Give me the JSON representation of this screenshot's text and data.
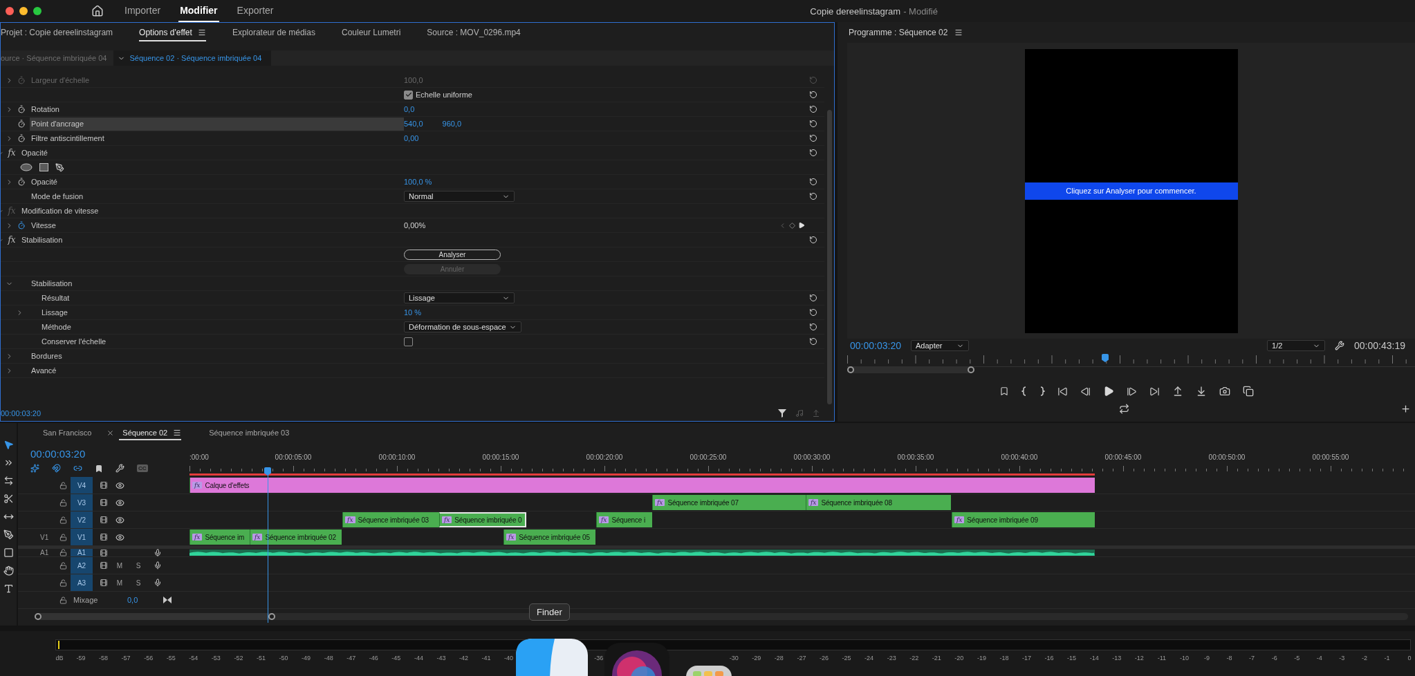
{
  "app_bar": {
    "nav": [
      {
        "label": "Importer",
        "selected": false
      },
      {
        "label": "Modifier",
        "selected": true
      },
      {
        "label": "Exporter",
        "selected": false
      }
    ],
    "title": "Copie dereelinstagram",
    "status": "- Modifié"
  },
  "effects_panel": {
    "tabs": [
      {
        "label": "Projet : Copie dereelinstagram",
        "selected": false
      },
      {
        "label": "Options d'effet",
        "selected": true
      },
      {
        "label": "Explorateur de médias",
        "selected": false
      },
      {
        "label": "Couleur Lumetri",
        "selected": false
      },
      {
        "label": "Source : MOV_0296.mp4",
        "selected": false
      }
    ],
    "source_tab": "ource · Séquence imbriquée 04",
    "sequence_tab": "Séquence 02 · Séquence imbriquée 04",
    "rows": [
      {
        "kind": "property",
        "label": "Largeur d'échelle",
        "values": [
          "100,0"
        ],
        "expandable": true,
        "stopwatch": true,
        "animated": false,
        "disabled": true,
        "highlighted": false,
        "reset": true
      },
      {
        "kind": "checkbox",
        "label": "Echelle uniforme",
        "checked": true,
        "reset": true
      },
      {
        "kind": "property",
        "label": "Rotation",
        "values": [
          "0,0"
        ],
        "expandable": true,
        "stopwatch": true,
        "animated": false,
        "disabled": false,
        "highlighted": false,
        "reset": true
      },
      {
        "kind": "property",
        "label": "Point d'ancrage",
        "values": [
          "540,0",
          "960,0"
        ],
        "expandable": false,
        "stopwatch": true,
        "animated": false,
        "disabled": false,
        "highlighted": true,
        "reset": true
      },
      {
        "kind": "property",
        "label": "Filtre antiscintillement",
        "values": [
          "0,00"
        ],
        "expandable": true,
        "stopwatch": true,
        "animated": false,
        "disabled": false,
        "highlighted": false,
        "reset": true
      },
      {
        "kind": "section",
        "badge": "fx",
        "label": "Opacité",
        "expanded": true,
        "enabled": true,
        "reset": true
      },
      {
        "kind": "masks"
      },
      {
        "kind": "property",
        "label": "Opacité",
        "values": [
          "100,0 %"
        ],
        "expandable": true,
        "stopwatch": true,
        "animated": false,
        "disabled": false,
        "highlighted": false,
        "reset": true
      },
      {
        "kind": "dropdown",
        "label": "Mode de fusion",
        "value": "Normal",
        "reset": true
      },
      {
        "kind": "section",
        "badge": "fx",
        "label": "Modification de vitesse",
        "expanded": true,
        "enabled": false,
        "reset": false
      },
      {
        "kind": "property",
        "label": "Vitesse",
        "values": [
          "0,00%"
        ],
        "expandable": true,
        "stopwatch": true,
        "animated": true,
        "disabled": false,
        "highlighted": false,
        "reset": false
      },
      {
        "kind": "section",
        "badge": "fx",
        "label": "Stabilisation",
        "expanded": true,
        "enabled": true,
        "reset": true
      },
      {
        "kind": "button",
        "label": "Analyser",
        "disabled": false
      },
      {
        "kind": "button",
        "label": "Annuler",
        "disabled": true
      },
      {
        "kind": "group",
        "label": "Stabilisation",
        "expanded": true,
        "children": [
          {
            "kind": "dropdown",
            "label": "Résultat",
            "value": "Lissage",
            "reset": true
          },
          {
            "kind": "property",
            "label": "Lissage",
            "values": [
              "10 %"
            ],
            "expandable": true,
            "stopwatch": false,
            "animated": false,
            "disabled": false,
            "highlighted": false,
            "reset": true
          },
          {
            "kind": "dropdown",
            "label": "Méthode",
            "value": "Déformation de sous-espace",
            "reset": true
          },
          {
            "kind": "check_property",
            "label": "Conserver l'échelle",
            "checked": false,
            "reset": true
          }
        ]
      },
      {
        "kind": "group",
        "label": "Bordures",
        "expanded": false
      },
      {
        "kind": "group",
        "label": "Avancé",
        "expanded": false
      }
    ],
    "timecode": "00:00:03:20"
  },
  "program_monitor": {
    "title": "Programme : Séquence 02",
    "overlay_message": "Cliquez sur Analyser pour commencer.",
    "timecode": "00:00:03:20",
    "zoom": "Adapter",
    "resolution": "1/2",
    "duration": "00:00:43:19"
  },
  "timeline": {
    "tabs": [
      {
        "label": "San Francisco",
        "selected": false,
        "closable": false
      },
      {
        "label": "Séquence 02",
        "selected": true,
        "closable": true
      },
      {
        "label": "Séquence imbriquée 03",
        "selected": false,
        "closable": false
      }
    ],
    "timecode": "00:00:03:20",
    "captions_label": "CC",
    "ruler": [
      ":00:00",
      "00:00:05:00",
      "00:00:10:00",
      "00:00:15:00",
      "00:00:20:00",
      "00:00:25:00",
      "00:00:30:00",
      "00:00:35:00",
      "00:00:40:00",
      "00:00:45:00",
      "00:00:50:00",
      "00:00:55:00"
    ],
    "tracks": [
      {
        "kind": "video",
        "name": "V4",
        "clips": [
          {
            "kind": "adjustment",
            "badge": "fx",
            "label": "Calque d'effets",
            "selected": false
          }
        ]
      },
      {
        "kind": "video",
        "name": "V3",
        "clips": [
          {
            "kind": "nested",
            "badge": "fx",
            "label": "Séquence imbriquée 07",
            "selected": false
          },
          {
            "kind": "nested",
            "badge": "fx",
            "label": "Séquence imbriquée 08",
            "selected": false
          }
        ]
      },
      {
        "kind": "video",
        "name": "V2",
        "clips": [
          {
            "kind": "nested",
            "badge": "fx",
            "label": "Séquence imbriquée 03",
            "selected": false
          },
          {
            "kind": "nested",
            "badge": "fx",
            "label": "Séquence imbriquée 0",
            "selected": true
          },
          {
            "kind": "nested",
            "badge": "fx",
            "label": "Séquence i",
            "selected": false
          },
          {
            "kind": "nested",
            "badge": "fx",
            "label": "Séquence imbriquée 09",
            "selected": false
          }
        ]
      },
      {
        "kind": "video",
        "source": "V1",
        "name": "V1",
        "clips": [
          {
            "kind": "nested",
            "badge": "fx",
            "label": "Séquence im",
            "selected": false
          },
          {
            "kind": "nested",
            "badge": "fx",
            "label": "Séquence imbriquée 02",
            "selected": false
          },
          {
            "kind": "nested",
            "badge": "fx",
            "label": "Séquence imbriquée 05",
            "selected": false
          }
        ]
      },
      {
        "kind": "audio",
        "source": "A1",
        "name": "A1",
        "clips": [
          {
            "kind": "waveform"
          }
        ]
      },
      {
        "kind": "audio",
        "name": "A2",
        "mute": "M",
        "solo": "S"
      },
      {
        "kind": "audio",
        "name": "A3",
        "mute": "M",
        "solo": "S"
      }
    ],
    "mix": {
      "label": "Mixage",
      "value": "0,0"
    }
  },
  "audio_meter": {
    "unit": "dB",
    "scale": [
      "-59",
      "-58",
      "-57",
      "-56",
      "-55",
      "-54",
      "-53",
      "-52",
      "-51",
      "-50",
      "-49",
      "-48",
      "-47",
      "-46",
      "-45",
      "-44",
      "-43",
      "-42",
      "-41",
      "-40",
      "-36",
      "-30",
      "-29",
      "-28",
      "-27",
      "-26",
      "-25",
      "-24",
      "-23",
      "-22",
      "-21",
      "-20",
      "-19",
      "-18",
      "-17",
      "-16",
      "-15",
      "-14",
      "-13",
      "-12",
      "-11",
      "-10",
      "-9",
      "-8",
      "-7",
      "-6",
      "-5",
      "-4",
      "-3",
      "-2",
      "-1",
      "0"
    ]
  },
  "dock": {
    "tooltip": "Finder"
  }
}
